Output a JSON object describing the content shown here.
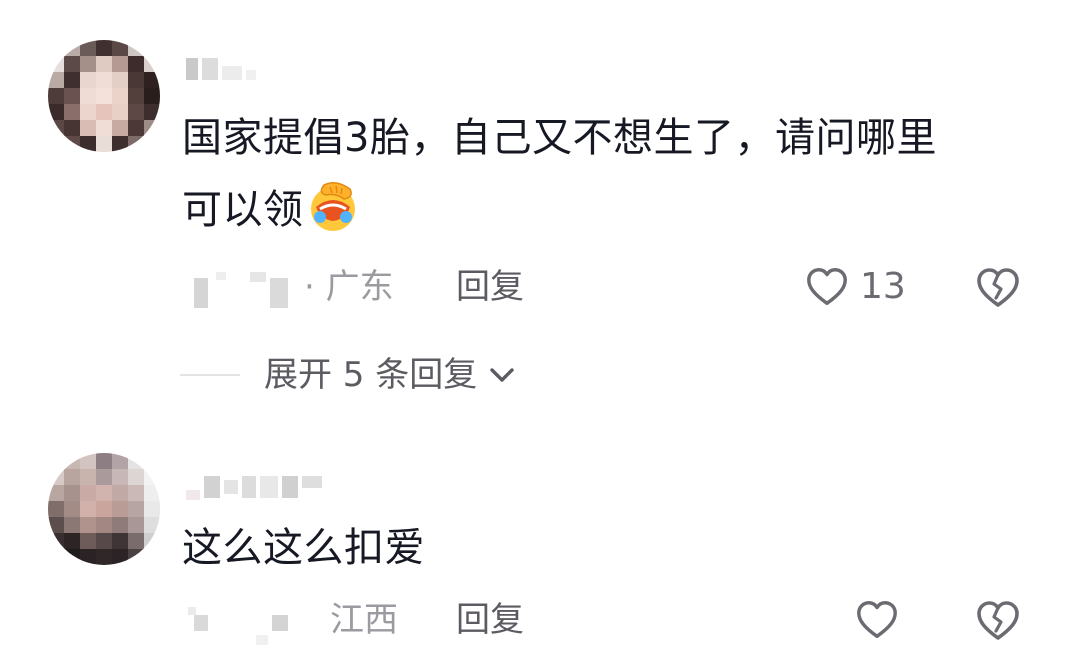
{
  "comments": [
    {
      "text_line1": "国家提倡3胎，自己又不想生了，请问哪里",
      "text_line2": "可以领",
      "emoji": "facepalm-laugh-emoji",
      "location": "· 广东",
      "reply_label": "回复",
      "like_count": "13",
      "expand_label": "展开 5 条回复"
    },
    {
      "text_line1": "这么这么扣爱",
      "location": "江西",
      "reply_label": "回复"
    }
  ],
  "icons": {
    "like": "heart-outline-icon",
    "dislike": "broken-heart-icon",
    "expand": "chevron-down-icon"
  },
  "colors": {
    "text": "#161823",
    "secondary": "#9a9aa0",
    "action": "#5b5b62",
    "icon": "#6b6b72"
  }
}
